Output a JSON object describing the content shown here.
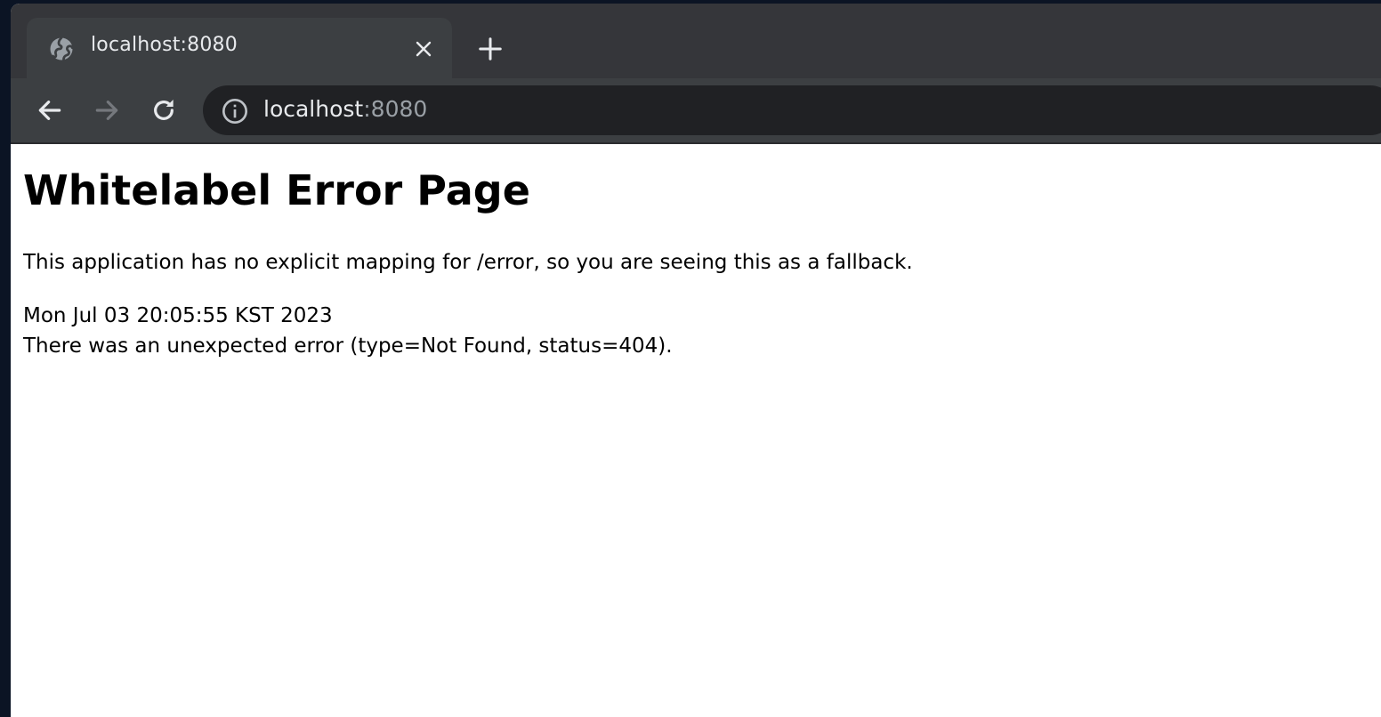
{
  "browser": {
    "tab": {
      "title": "localhost:8080",
      "favicon": "globe-icon"
    },
    "toolbar": {
      "address": {
        "host": "localhost",
        "port": ":8080"
      },
      "icons": {
        "back": "arrow-left-icon",
        "forward": "arrow-right-icon",
        "reload": "reload-icon",
        "site_info": "info-icon",
        "close_tab": "close-icon",
        "new_tab": "plus-icon"
      }
    }
  },
  "page": {
    "heading": "Whitelabel Error Page",
    "description": "This application has no explicit mapping for /error, so you are seeing this as a fallback.",
    "timestamp": "Mon Jul 03 20:05:55 KST 2023",
    "error_message": "There was an unexpected error (type=Not Found, status=404)."
  },
  "colors": {
    "tabstrip": "#35363a",
    "toolbar": "#3c3f42",
    "omnibox": "#202124",
    "text_light": "#e8eaed",
    "text_muted": "#9aa0a6",
    "desktop": "#0b1424"
  }
}
